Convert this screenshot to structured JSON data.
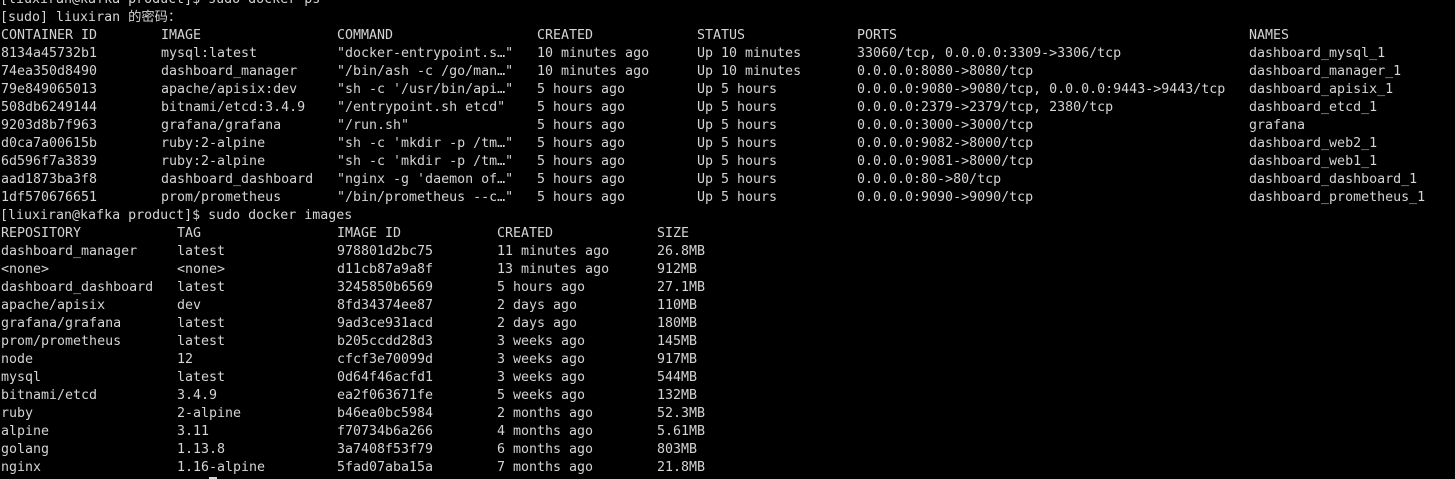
{
  "prompt_lines": {
    "ps_command": "[liuxiran@kafka product]$ sudo docker ps",
    "sudo_prompt": "[sudo] liuxiran 的密码：",
    "images_command": "[liuxiran@kafka product]$ sudo docker images"
  },
  "ps": {
    "headers": [
      "CONTAINER ID",
      "IMAGE",
      "COMMAND",
      "CREATED",
      "STATUS",
      "PORTS",
      "NAMES"
    ],
    "rows": [
      [
        "8134a45732b1",
        "mysql:latest",
        "\"docker-entrypoint.s…\"",
        "10 minutes ago",
        "Up 10 minutes",
        "33060/tcp, 0.0.0.0:3309->3306/tcp",
        "dashboard_mysql_1"
      ],
      [
        "74ea350d8490",
        "dashboard_manager",
        "\"/bin/ash -c /go/man…\"",
        "10 minutes ago",
        "Up 10 minutes",
        "0.0.0.0:8080->8080/tcp",
        "dashboard_manager_1"
      ],
      [
        "79e849065013",
        "apache/apisix:dev",
        "\"sh -c '/usr/bin/api…\"",
        "5 hours ago",
        "Up 5 hours",
        "0.0.0.0:9080->9080/tcp, 0.0.0.0:9443->9443/tcp",
        "dashboard_apisix_1"
      ],
      [
        "508db6249144",
        "bitnami/etcd:3.4.9",
        "\"/entrypoint.sh etcd\"",
        "5 hours ago",
        "Up 5 hours",
        "0.0.0.0:2379->2379/tcp, 2380/tcp",
        "dashboard_etcd_1"
      ],
      [
        "9203d8b7f963",
        "grafana/grafana",
        "\"/run.sh\"",
        "5 hours ago",
        "Up 5 hours",
        "0.0.0.0:3000->3000/tcp",
        "grafana"
      ],
      [
        "d0ca7a00615b",
        "ruby:2-alpine",
        "\"sh -c 'mkdir -p /tm…\"",
        "5 hours ago",
        "Up 5 hours",
        "0.0.0.0:9082->8000/tcp",
        "dashboard_web2_1"
      ],
      [
        "6d596f7a3839",
        "ruby:2-alpine",
        "\"sh -c 'mkdir -p /tm…\"",
        "5 hours ago",
        "Up 5 hours",
        "0.0.0.0:9081->8000/tcp",
        "dashboard_web1_1"
      ],
      [
        "aad1873ba3f8",
        "dashboard_dashboard",
        "\"nginx -g 'daemon of…\"",
        "5 hours ago",
        "Up 5 hours",
        "0.0.0.0:80->80/tcp",
        "dashboard_dashboard_1"
      ],
      [
        "1df570676651",
        "prom/prometheus",
        "\"/bin/prometheus --c…\"",
        "5 hours ago",
        "Up 5 hours",
        "0.0.0.0:9090->9090/tcp",
        "dashboard_prometheus_1"
      ]
    ]
  },
  "images": {
    "headers": [
      "REPOSITORY",
      "TAG",
      "IMAGE ID",
      "CREATED",
      "SIZE"
    ],
    "rows": [
      [
        "dashboard_manager",
        "latest",
        "978801d2bc75",
        "11 minutes ago",
        "26.8MB"
      ],
      [
        "<none>",
        "<none>",
        "d11cb87a9a8f",
        "13 minutes ago",
        "912MB"
      ],
      [
        "dashboard_dashboard",
        "latest",
        "3245850b6569",
        "5 hours ago",
        "27.1MB"
      ],
      [
        "apache/apisix",
        "dev",
        "8fd34374ee87",
        "2 days ago",
        "110MB"
      ],
      [
        "grafana/grafana",
        "latest",
        "9ad3ce931acd",
        "2 days ago",
        "180MB"
      ],
      [
        "prom/prometheus",
        "latest",
        "b205ccdd28d3",
        "3 weeks ago",
        "145MB"
      ],
      [
        "node",
        "12",
        "cfcf3e70099d",
        "3 weeks ago",
        "917MB"
      ],
      [
        "mysql",
        "latest",
        "0d64f46acfd1",
        "3 weeks ago",
        "544MB"
      ],
      [
        "bitnami/etcd",
        "3.4.9",
        "ea2f063671fe",
        "5 weeks ago",
        "132MB"
      ],
      [
        "ruby",
        "2-alpine",
        "b46ea0bc5984",
        "2 months ago",
        "52.3MB"
      ],
      [
        "alpine",
        "3.11",
        "f70734b6a266",
        "4 months ago",
        "5.61MB"
      ],
      [
        "golang",
        "1.13.8",
        "3a7408f53f79",
        "6 months ago",
        "803MB"
      ],
      [
        "nginx",
        "1.16-alpine",
        "5fad07aba15a",
        "7 months ago",
        "21.8MB"
      ]
    ]
  }
}
